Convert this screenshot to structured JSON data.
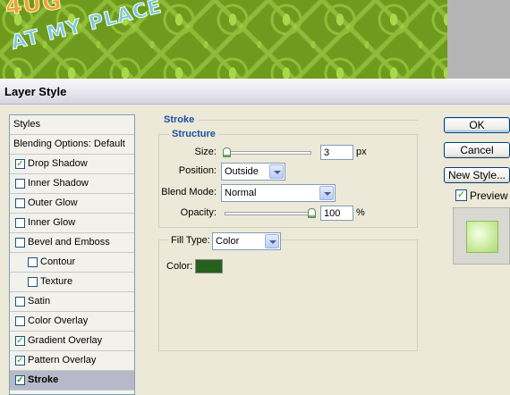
{
  "canvas": {
    "text_line_1": "4UG",
    "text_line_2": "AT MY PLACE"
  },
  "dialog": {
    "title": "Layer Style"
  },
  "styles_list": [
    {
      "label": "Styles",
      "type": "header",
      "checked": null,
      "selected": false
    },
    {
      "label": "Blending Options: Default",
      "type": "header",
      "checked": null,
      "selected": false
    },
    {
      "label": "Drop Shadow",
      "type": "item",
      "checked": true,
      "selected": false
    },
    {
      "label": "Inner Shadow",
      "type": "item",
      "checked": false,
      "selected": false
    },
    {
      "label": "Outer Glow",
      "type": "item",
      "checked": false,
      "selected": false
    },
    {
      "label": "Inner Glow",
      "type": "item",
      "checked": false,
      "selected": false
    },
    {
      "label": "Bevel and Emboss",
      "type": "item",
      "checked": false,
      "selected": false
    },
    {
      "label": "Contour",
      "type": "sub",
      "checked": false,
      "selected": false
    },
    {
      "label": "Texture",
      "type": "sub",
      "checked": false,
      "selected": false
    },
    {
      "label": "Satin",
      "type": "item",
      "checked": false,
      "selected": false
    },
    {
      "label": "Color Overlay",
      "type": "item",
      "checked": false,
      "selected": false
    },
    {
      "label": "Gradient Overlay",
      "type": "item",
      "checked": true,
      "selected": false
    },
    {
      "label": "Pattern Overlay",
      "type": "item",
      "checked": true,
      "selected": false
    },
    {
      "label": "Stroke",
      "type": "item",
      "checked": true,
      "selected": true
    }
  ],
  "stroke": {
    "section_title": "Stroke",
    "structure_title": "Structure",
    "size_label": "Size:",
    "size_value": "3",
    "size_unit": "px",
    "position_label": "Position:",
    "position_value": "Outside",
    "blend_mode_label": "Blend Mode:",
    "blend_mode_value": "Normal",
    "opacity_label": "Opacity:",
    "opacity_value": "100",
    "opacity_unit": "%",
    "fill_type_label": "Fill Type:",
    "fill_type_value": "Color",
    "color_label": "Color:",
    "color_value": "#26601E"
  },
  "buttons": {
    "ok": "OK",
    "cancel": "Cancel",
    "new_style": "New Style...",
    "preview_label": "Preview",
    "preview_checked": true
  },
  "colors": {
    "accent_blue": "#1E4DA1",
    "selected_row": "#B7B9C8",
    "stroke_color": "#26601E",
    "check_green": "#21A121"
  }
}
